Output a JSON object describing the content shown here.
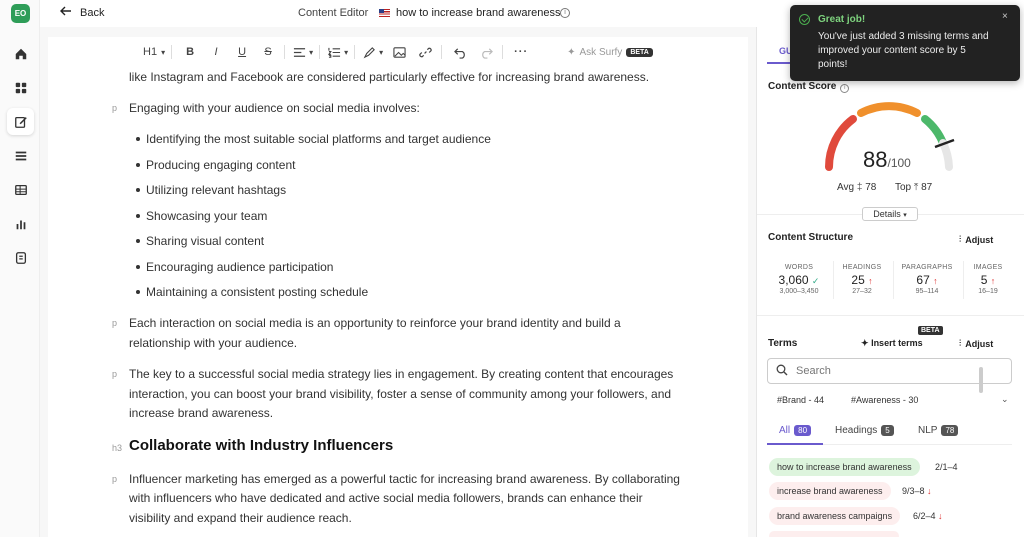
{
  "rail": {
    "avatar_initials": "EO",
    "icons": [
      "home-icon",
      "dashboard-icon",
      "edit-icon",
      "list-icon",
      "table-icon",
      "chart-icon",
      "document-icon"
    ]
  },
  "topbar": {
    "back_label": "Back",
    "breadcrumb": "Content Editor",
    "doc_title": "how to increase brand awareness"
  },
  "toolbar": {
    "heading_label": "H1",
    "ask_label": "Ask Surfy",
    "beta_label": "BETA"
  },
  "editor": {
    "para_top": "like Instagram and Facebook are considered particularly effective for increasing brand awareness.",
    "para_1": "Engaging with your audience on social media involves:",
    "bullets": [
      "Identifying the most suitable social platforms and target audience",
      "Producing engaging content",
      "Utilizing relevant hashtags",
      "Showcasing your team",
      "Sharing visual content",
      "Encouraging audience participation",
      "Maintaining a consistent posting schedule"
    ],
    "para_2a": "Each interaction on social media is an opportunity to reinforce your brand identity and build a",
    "para_2b": "relationship with your audience.",
    "para_3a": "The key to a successful social media strategy lies in engagement. By creating content that encourages",
    "para_3b": "interaction, you can boost your brand visibility, foster a sense of community among your followers, and",
    "para_3c": "increase brand awareness.",
    "h3_tag": "h3",
    "heading": "Collaborate with Industry Influencers",
    "para_4a": "Influencer marketing has emerged as a powerful tactic for increasing brand awareness. By collaborating",
    "para_4b": "with influencers who have dedicated and active social media followers, brands can enhance their",
    "para_4c": "visibility and expand their audience reach.",
    "p_tag": "p"
  },
  "panel": {
    "tab_label": "GU",
    "content_score_title": "Content Score",
    "score": "88",
    "score_max": "/100",
    "score_value": 88,
    "avg_label": "Avg",
    "avg_value": "78",
    "top_label": "Top",
    "top_value": "87",
    "details_label": "Details",
    "structure_title": "Content Structure",
    "adjust_label": "Adjust",
    "stats": [
      {
        "label": "WORDS",
        "value": "3,060",
        "range": "3,000–3,450",
        "mark": "✓"
      },
      {
        "label": "HEADINGS",
        "value": "25",
        "range": "27–32",
        "mark": "↑"
      },
      {
        "label": "PARAGRAPHS",
        "value": "67",
        "range": "95–114",
        "mark": "↑"
      },
      {
        "label": "IMAGES",
        "value": "5",
        "range": "16–19",
        "mark": "↑"
      }
    ],
    "terms_title": "Terms",
    "insert_terms_label": "Insert terms",
    "beta_label": "BETA",
    "search_placeholder": "Search",
    "hashtags": [
      "#Brand - 44",
      "#Awareness - 30"
    ],
    "term_tabs": [
      {
        "label": "All",
        "count": "80"
      },
      {
        "label": "Headings",
        "count": "5"
      },
      {
        "label": "NLP",
        "count": "78"
      }
    ],
    "terms": [
      {
        "text": "how to increase brand awareness",
        "count": "2/1–4",
        "arrow": ""
      },
      {
        "text": "increase brand awareness",
        "count": "9/3–8",
        "arrow": "↓"
      },
      {
        "text": "brand awareness campaigns",
        "count": "6/2–4",
        "arrow": "↓"
      }
    ]
  },
  "toast": {
    "title": "Great job!",
    "message": "You've just added 3 missing terms and improved your content score by 5 points!",
    "close": "×"
  },
  "colors": {
    "accent": "#6a5acd",
    "brand_green": "#2e9d58",
    "gauge_red": "#e04a3c",
    "gauge_orange": "#f0902c",
    "gauge_green": "#4cb86a"
  }
}
